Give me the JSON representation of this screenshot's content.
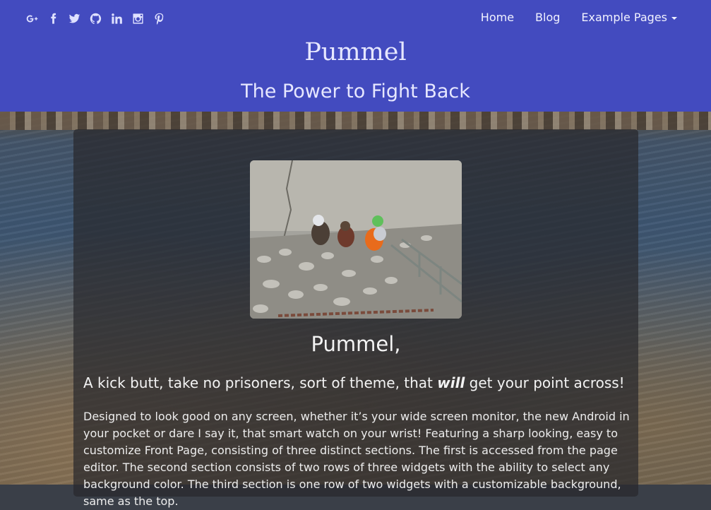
{
  "social": {
    "icons": [
      "google-plus-icon",
      "facebook-icon",
      "twitter-icon",
      "github-icon",
      "linkedin-icon",
      "instagram-icon",
      "pinterest-icon"
    ]
  },
  "nav": {
    "home": "Home",
    "blog": "Blog",
    "example_pages": "Example Pages"
  },
  "site": {
    "title": "Pummel",
    "tagline": "The Power to Fight Back"
  },
  "post": {
    "title": "Pummel,",
    "lead_before": "A kick butt, take no prisoners, sort of theme, that ",
    "lead_em": "will",
    "lead_after": " get your point across!",
    "body": "Designed to look good on any screen, whether it’s your wide screen monitor, the new Android in your pocket or dare I say it, that smart watch on your wrist! Featuring a sharp looking, easy to customize Front Page, consisting of three distinct sections. The first is accessed from the page editor. The second section consists of two rows of three widgets with the ability to select any background color. The third section is one row of two widgets with a customizable background, same as the top."
  },
  "colors": {
    "header_bg": "#434bbf",
    "panel_bg": "rgba(40,40,44,0.72)"
  }
}
